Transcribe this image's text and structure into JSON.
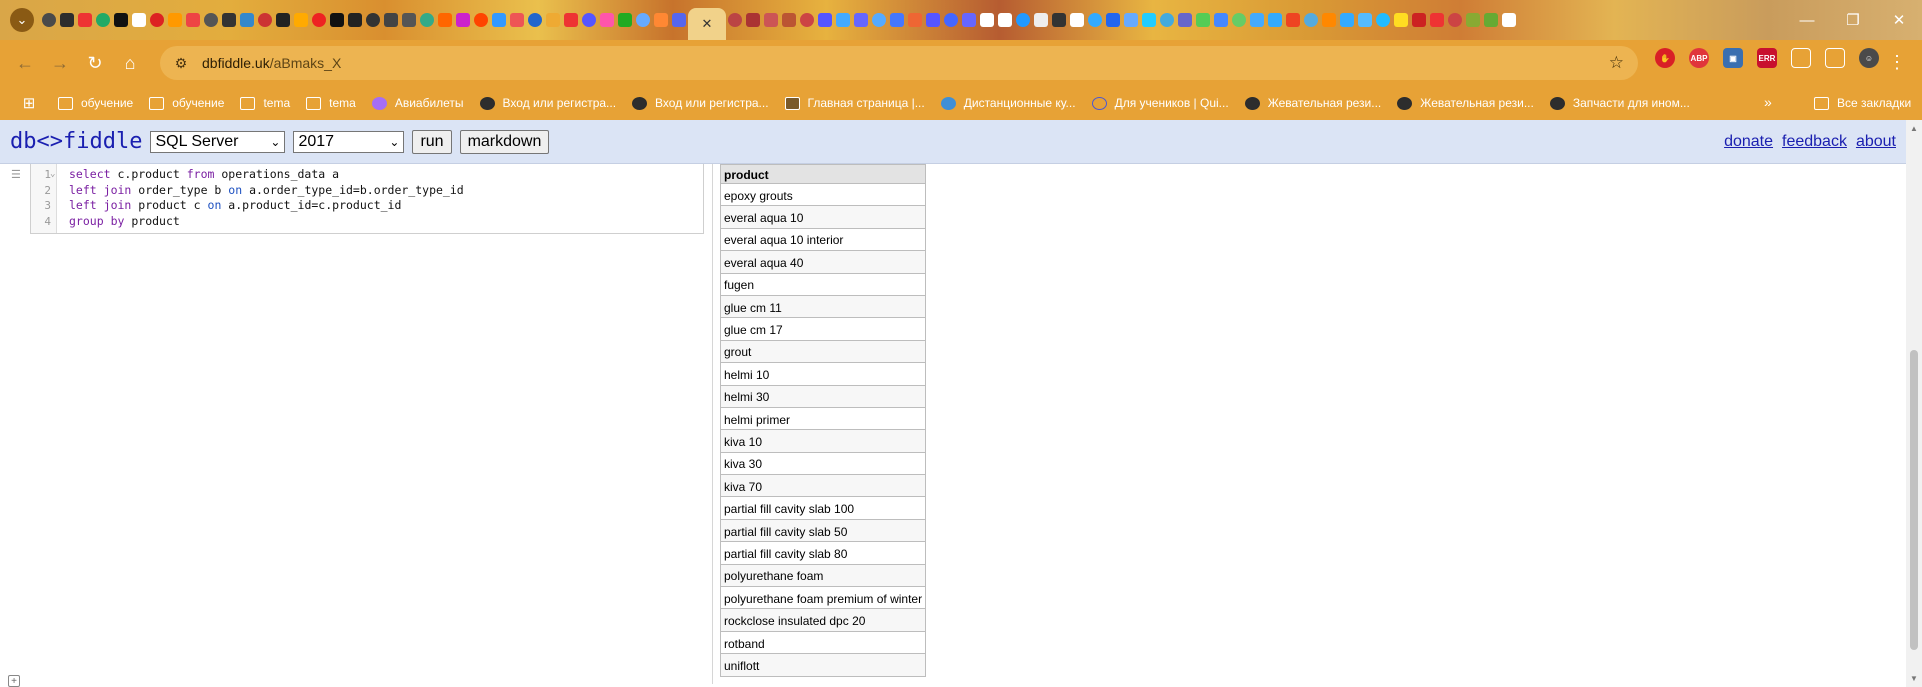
{
  "browser": {
    "address": {
      "host": "dbfiddle.uk",
      "path": "/aBmaks_X"
    },
    "bookmarks": [
      {
        "label": "обучение",
        "icon": "folder-icon"
      },
      {
        "label": "обучение",
        "icon": "folder-icon"
      },
      {
        "label": "tema",
        "icon": "folder-icon"
      },
      {
        "label": "tema",
        "icon": "folder-icon"
      },
      {
        "label": "Авиабилеты",
        "icon": "colored-circle-icon"
      },
      {
        "label": "Вход или регистра...",
        "icon": "dark-circle-icon"
      },
      {
        "label": "Вход или регистра...",
        "icon": "dark-circle-icon"
      },
      {
        "label": "Главная страница |...",
        "icon": "page-icon"
      },
      {
        "label": "Дистанционные ку...",
        "icon": "globe-icon"
      },
      {
        "label": "Для учеников | Qui...",
        "icon": "q-icon"
      },
      {
        "label": "Жевательная рези...",
        "icon": "dark-circle-icon"
      },
      {
        "label": "Жевательная рези...",
        "icon": "dark-circle-icon"
      },
      {
        "label": "Запчасти для ином...",
        "icon": "dark-circle-icon"
      }
    ],
    "all_bookmarks_label": "Все закладки",
    "more_label": "»"
  },
  "dbfiddle": {
    "logo": "db<>fiddle",
    "engine": "SQL Server",
    "version": "2017",
    "run_label": "run",
    "markdown_label": "markdown",
    "links": [
      "donate",
      "feedback",
      "about"
    ]
  },
  "editor": {
    "lines": [
      {
        "num": "1",
        "tokens": [
          [
            "kw",
            "select"
          ],
          [
            "t",
            " c.product "
          ],
          [
            "kw",
            "from"
          ],
          [
            "t",
            " operations_data a"
          ]
        ]
      },
      {
        "num": "2",
        "tokens": [
          [
            "kw",
            "left"
          ],
          [
            "t",
            " "
          ],
          [
            "kw",
            "join"
          ],
          [
            "t",
            " order_type b "
          ],
          [
            "kw2",
            "on"
          ],
          [
            "t",
            " a.order_type_id=b.order_type_id"
          ]
        ]
      },
      {
        "num": "3",
        "tokens": [
          [
            "kw",
            "left"
          ],
          [
            "t",
            " "
          ],
          [
            "kw",
            "join"
          ],
          [
            "t",
            " product c "
          ],
          [
            "kw2",
            "on"
          ],
          [
            "t",
            " a.product_id=c.product_id"
          ]
        ]
      },
      {
        "num": "4",
        "tokens": [
          [
            "kw",
            "group"
          ],
          [
            "t",
            " "
          ],
          [
            "kw",
            "by"
          ],
          [
            "t",
            " product"
          ]
        ]
      }
    ]
  },
  "results": {
    "header": "product",
    "rows": [
      "epoxy grouts",
      "everal aqua 10",
      "everal aqua 10 interior",
      "everal aqua 40",
      "fugen",
      "glue cm 11",
      "glue cm 17",
      "grout",
      "helmi 10",
      "helmi 30",
      "helmi primer",
      "kiva 10",
      "kiva 30",
      "kiva 70",
      "partial fill cavity slab 100",
      "partial fill cavity slab 50",
      "partial fill cavity slab 80",
      "polyurethane foam",
      "polyurethane foam premium of winter",
      "rockclose insulated dpc 20",
      "rotband",
      "uniflott"
    ]
  }
}
